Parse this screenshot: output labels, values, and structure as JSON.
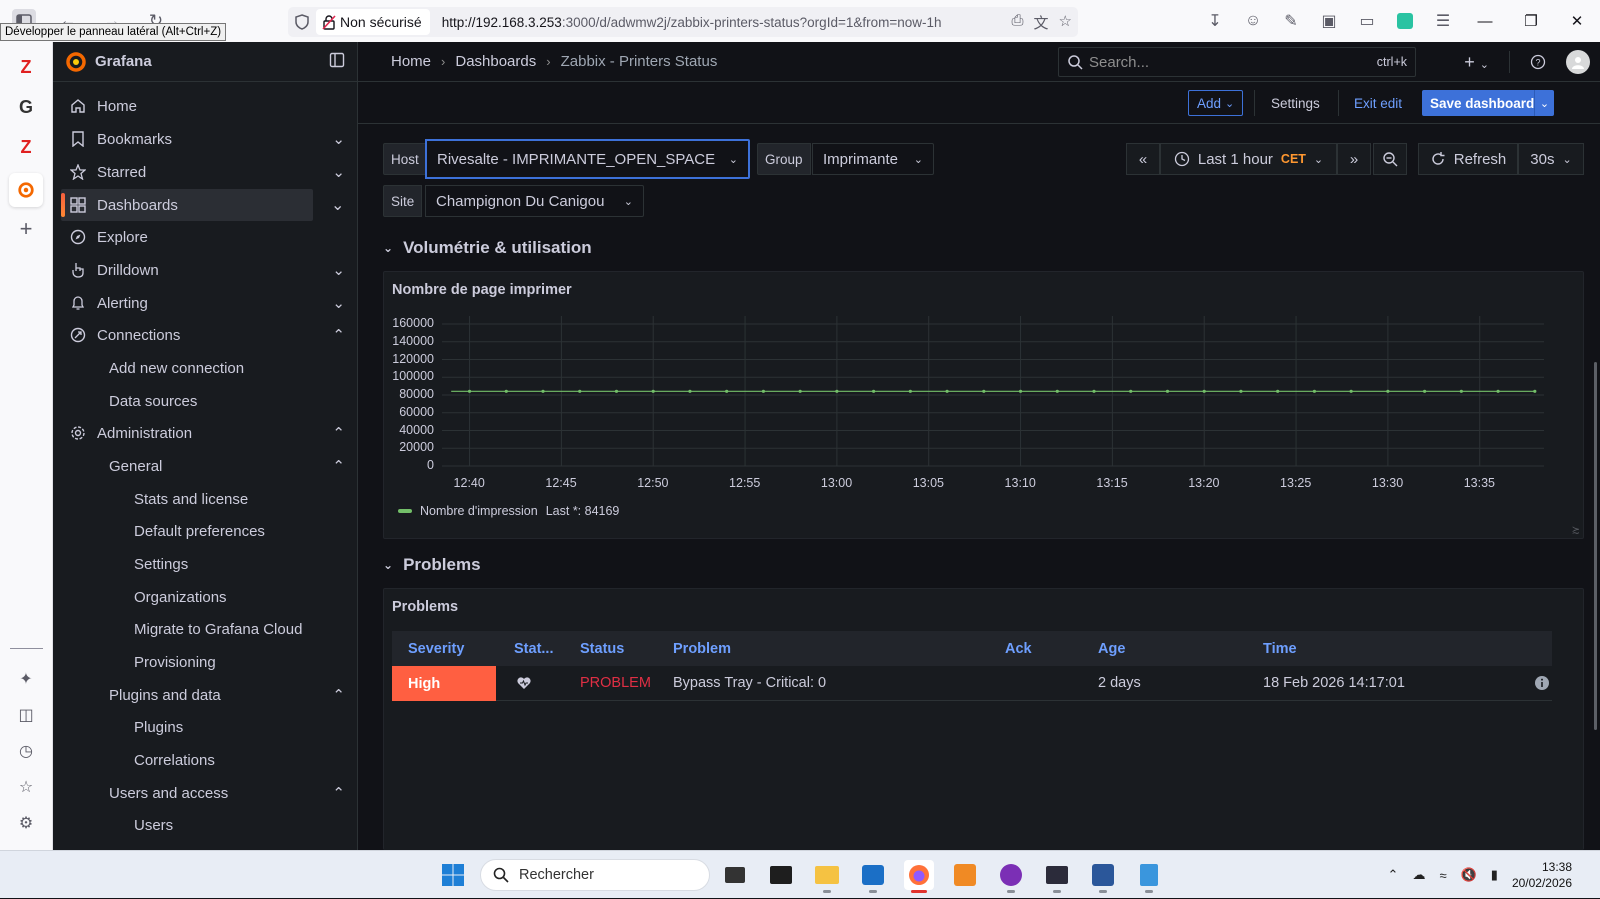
{
  "browser": {
    "tooltip": "Développer le panneau latéral (Alt+Ctrl+Z)",
    "not_secure": "Non sécurisé",
    "url_host": "http://192.168.3.253",
    "url_rest": ":3000/d/adwmw2j/zabbix-printers-status?orgId=1&from=now-1h"
  },
  "grafana": {
    "brand": "Grafana",
    "nav": {
      "home": "Home",
      "bookmarks": "Bookmarks",
      "starred": "Starred",
      "dashboards": "Dashboards",
      "explore": "Explore",
      "drilldown": "Drilldown",
      "alerting": "Alerting",
      "connections": "Connections",
      "add_new_connection": "Add new connection",
      "data_sources": "Data sources",
      "administration": "Administration",
      "general": "General",
      "stats_and_license": "Stats and license",
      "default_preferences": "Default preferences",
      "settings": "Settings",
      "organizations": "Organizations",
      "migrate": "Migrate to Grafana Cloud",
      "provisioning": "Provisioning",
      "plugins_and_data": "Plugins and data",
      "plugins": "Plugins",
      "correlations": "Correlations",
      "users_and_access": "Users and access",
      "users": "Users"
    },
    "breadcrumb": {
      "home": "Home",
      "dashboards": "Dashboards",
      "current": "Zabbix - Printers Status"
    },
    "search": {
      "placeholder": "Search...",
      "shortcut": "ctrl+k"
    },
    "editbar": {
      "add": "Add",
      "settings": "Settings",
      "exit_edit": "Exit edit",
      "save": "Save dashboard"
    },
    "variables": {
      "host_label": "Host",
      "host_value": "Rivesalte - IMPRIMANTE_OPEN_SPACE",
      "group_label": "Group",
      "group_value": "Imprimante",
      "site_label": "Site",
      "site_value": "Champignon Du Canigou"
    },
    "timepicker": {
      "range": "Last 1 hour",
      "tz": "CET",
      "refresh": "Refresh",
      "interval": "30s"
    },
    "rows": {
      "volumetrie": "Volumétrie & utilisation",
      "problems": "Problems"
    },
    "chart_panel": {
      "title": "Nombre de page imprimer",
      "legend_name": "Nombre d'impression",
      "legend_last": "Last *: 84169"
    },
    "problems_panel": {
      "title": "Problems",
      "columns": [
        "Severity",
        "Stat...",
        "Status",
        "Problem",
        "Ack",
        "Age",
        "Time"
      ],
      "row": {
        "severity": "High",
        "status": "PROBLEM",
        "problem": "Bypass Tray - Critical: 0",
        "ack": "",
        "age": "2 days",
        "time": "18 Feb 2026 14:17:01"
      }
    },
    "colors": {
      "accent": "#3d71d9",
      "high": "#ff5f41",
      "series": "#73bf69",
      "problem": "#e02f44"
    }
  },
  "chart_data": {
    "type": "line",
    "title": "Nombre de page imprimer",
    "xlabel": "",
    "ylabel": "",
    "ylim": [
      0,
      160000
    ],
    "yticks": [
      "160000",
      "140000",
      "120000",
      "100000",
      "80000",
      "60000",
      "40000",
      "20000",
      "0"
    ],
    "xticks": [
      "12:40",
      "12:45",
      "12:50",
      "12:55",
      "13:00",
      "13:05",
      "13:10",
      "13:15",
      "13:20",
      "13:25",
      "13:30",
      "13:35"
    ],
    "grid": true,
    "legend_placement": "bottom-left",
    "series": [
      {
        "name": "Nombre d'impression",
        "x": [
          "12:39",
          "12:40",
          "12:41",
          "12:42",
          "12:43",
          "12:44",
          "12:45",
          "12:46",
          "12:47",
          "12:48",
          "12:49",
          "12:50",
          "12:51",
          "12:52",
          "12:53",
          "12:54",
          "12:55",
          "12:56",
          "12:57",
          "12:58",
          "12:59",
          "13:00",
          "13:01",
          "13:02",
          "13:03",
          "13:04",
          "13:05",
          "13:06",
          "13:07",
          "13:08",
          "13:09",
          "13:10",
          "13:11",
          "13:12",
          "13:13",
          "13:14",
          "13:15",
          "13:16",
          "13:17",
          "13:18",
          "13:19",
          "13:20",
          "13:21",
          "13:22",
          "13:23",
          "13:24",
          "13:25",
          "13:26",
          "13:27",
          "13:28",
          "13:29",
          "13:30",
          "13:31",
          "13:32",
          "13:33",
          "13:34",
          "13:35",
          "13:36",
          "13:37",
          "13:38"
        ],
        "values": [
          84169,
          84169,
          84169,
          84169,
          84169,
          84169,
          84169,
          84169,
          84169,
          84169,
          84169,
          84169,
          84169,
          84169,
          84169,
          84169,
          84169,
          84169,
          84169,
          84169,
          84169,
          84169,
          84169,
          84169,
          84169,
          84169,
          84169,
          84169,
          84169,
          84169,
          84169,
          84169,
          84169,
          84169,
          84169,
          84169,
          84169,
          84169,
          84169,
          84169,
          84169,
          84169,
          84169,
          84169,
          84169,
          84169,
          84169,
          84169,
          84169,
          84169,
          84169,
          84169,
          84169,
          84169,
          84169,
          84169,
          84169,
          84169,
          84169,
          84169
        ]
      }
    ]
  },
  "taskbar": {
    "search": "Rechercher",
    "time": "13:38",
    "date": "20/02/2026"
  }
}
